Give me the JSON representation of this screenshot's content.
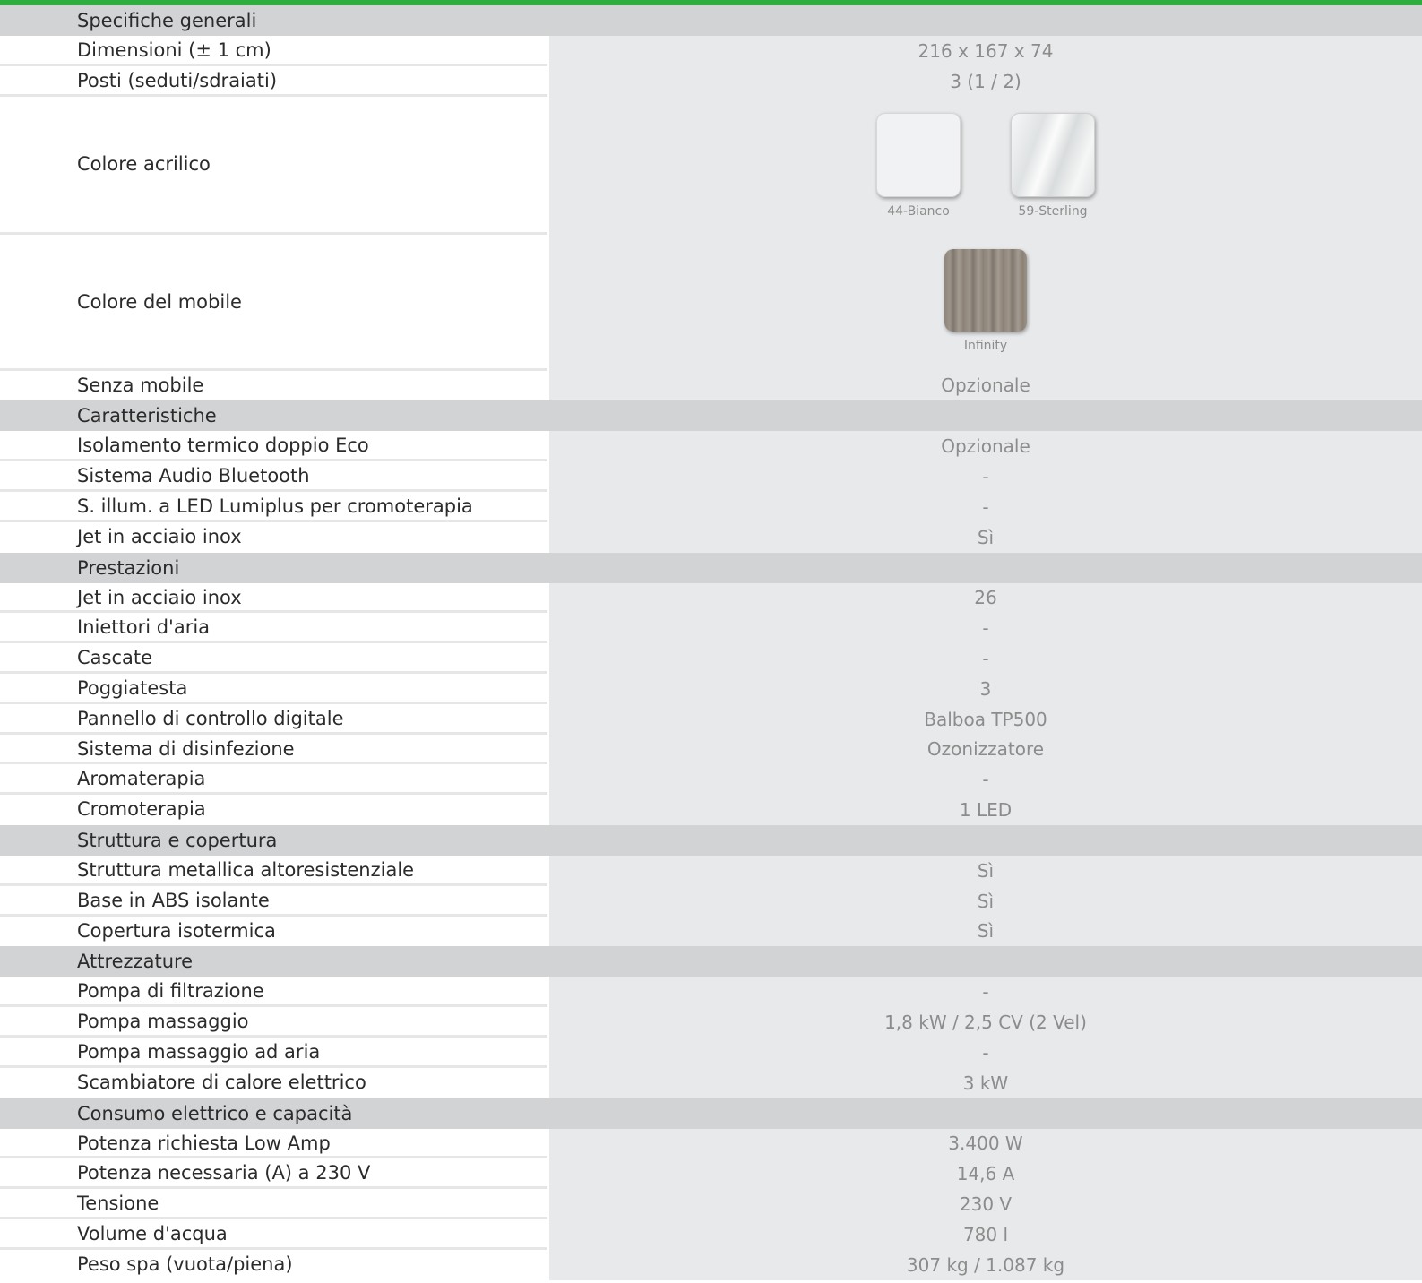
{
  "sections": [
    {
      "title": "Specifiche generali",
      "rows": [
        {
          "label": "Dimensioni (± 1 cm)",
          "value": "216 x 167 x 74"
        },
        {
          "label": "Posti (seduti/sdraiati)",
          "value": "3 (1 / 2)"
        }
      ]
    }
  ],
  "acrylic": {
    "label": "Colore acrilico",
    "swatches": [
      {
        "name": "44-Bianco",
        "color": "#f1f2f4"
      },
      {
        "name": "59-Sterling",
        "color": "#e6e8e9"
      }
    ]
  },
  "cabinet": {
    "label": "Colore del mobile",
    "swatches": [
      {
        "name": "Infinity",
        "color": "#8f857b"
      }
    ]
  },
  "general_tail": [
    {
      "label": "Senza mobile",
      "value": "Opzionale"
    }
  ],
  "groups": [
    {
      "title": "Caratteristiche",
      "rows": [
        {
          "label": "Isolamento termico doppio Eco",
          "value": "Opzionale"
        },
        {
          "label": "Sistema Audio Bluetooth",
          "value": "-"
        },
        {
          "label": "S. illum. a LED Lumiplus per cromoterapia",
          "value": "-"
        },
        {
          "label": "Jet in acciaio inox",
          "value": "Sì"
        }
      ]
    },
    {
      "title": "Prestazioni",
      "rows": [
        {
          "label": "Jet in acciaio inox",
          "value": "26"
        },
        {
          "label": "Iniettori d'aria",
          "value": "-"
        },
        {
          "label": "Cascate",
          "value": "-"
        },
        {
          "label": "Poggiatesta",
          "value": "3"
        },
        {
          "label": "Pannello di controllo digitale",
          "value": "Balboa TP500"
        },
        {
          "label": "Sistema di disinfezione",
          "value": "Ozonizzatore"
        },
        {
          "label": "Aromaterapia",
          "value": "-"
        },
        {
          "label": "Cromoterapia",
          "value": "1 LED"
        }
      ]
    },
    {
      "title": "Struttura e copertura",
      "rows": [
        {
          "label": "Struttura metallica altoresistenziale",
          "value": "Sì"
        },
        {
          "label": "Base in ABS isolante",
          "value": "Sì"
        },
        {
          "label": "Copertura isotermica",
          "value": "Sì"
        }
      ]
    },
    {
      "title": "Attrezzature",
      "rows": [
        {
          "label": "Pompa di filtrazione",
          "value": "-"
        },
        {
          "label": "Pompa massaggio",
          "value": "1,8 kW / 2,5 CV (2 Vel)"
        },
        {
          "label": "Pompa massaggio ad aria",
          "value": "-"
        },
        {
          "label": "Scambiatore di calore elettrico",
          "value": "3 kW"
        }
      ]
    },
    {
      "title": "Consumo elettrico e capacità",
      "rows": [
        {
          "label": "Potenza richiesta Low Amp",
          "value": "3.400 W"
        },
        {
          "label": "Potenza necessaria (A) a 230 V",
          "value": "14,6 A"
        },
        {
          "label": "Tensione",
          "value": "230 V"
        },
        {
          "label": "Volume d'acqua",
          "value": "780 l"
        },
        {
          "label": "Peso spa (vuota/piena)",
          "value": "307 kg / 1.087 kg"
        }
      ]
    }
  ]
}
